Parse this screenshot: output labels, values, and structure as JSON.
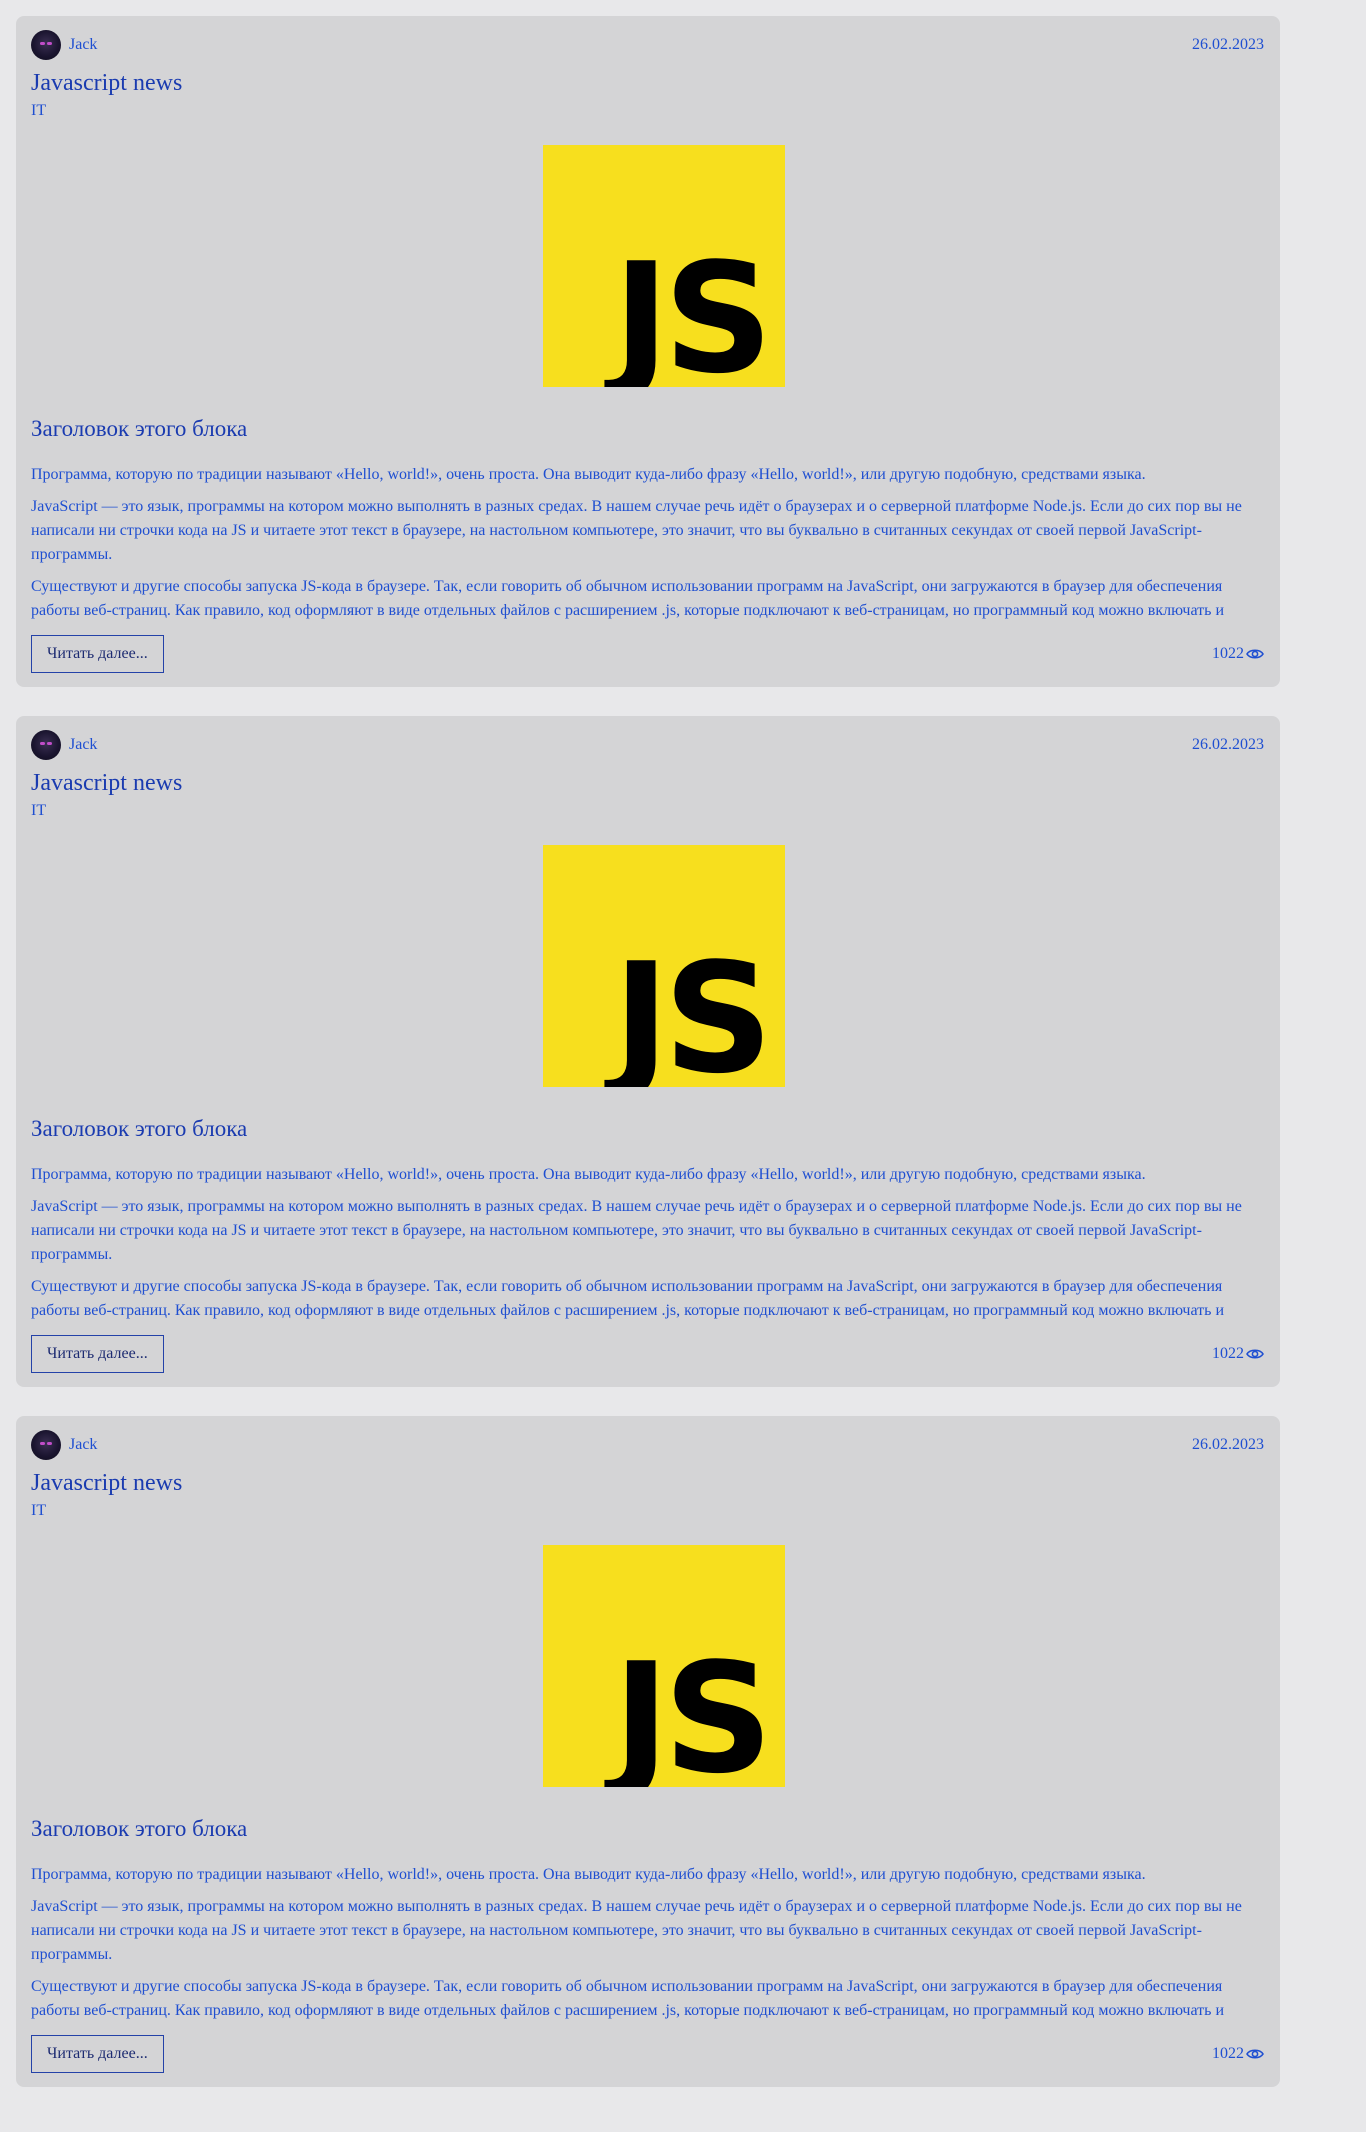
{
  "posts": [
    {
      "author": "Jack",
      "date": "26.02.2023",
      "title": "Javascript news",
      "category": "IT",
      "image_text": "JS",
      "block_heading": "Заголовок этого блока",
      "paragraphs": [
        "Программа, которую по традиции называют «Hello, world!», очень проста. Она выводит куда-либо фразу «Hello, world!», или другую подобную, средствами языка.",
        "JavaScript — это язык, программы на котором можно выполнять в разных средах. В нашем случае речь идёт о браузерах и о серверной платформе Node.js. Если до сих пор вы не написали ни строчки кода на JS и читаете этот текст в браузере, на настольном компьютере, это значит, что вы буквально в считанных секундах от своей первой JavaScript-программы.",
        "Существуют и другие способы запуска JS-кода в браузере. Так, если говорить об обычном использовании программ на JavaScript, они загружаются в браузер для обеспечения работы веб-страниц. Как правило, код оформляют в виде отдельных файлов с расширением .js, которые подключают к веб-страницам, но программный код можно включать и"
      ],
      "read_more_label": "Читать далее...",
      "views": "1022"
    },
    {
      "author": "Jack",
      "date": "26.02.2023",
      "title": "Javascript news",
      "category": "IT",
      "image_text": "JS",
      "block_heading": "Заголовок этого блока",
      "paragraphs": [
        "Программа, которую по традиции называют «Hello, world!», очень проста. Она выводит куда-либо фразу «Hello, world!», или другую подобную, средствами языка.",
        "JavaScript — это язык, программы на котором можно выполнять в разных средах. В нашем случае речь идёт о браузерах и о серверной платформе Node.js. Если до сих пор вы не написали ни строчки кода на JS и читаете этот текст в браузере, на настольном компьютере, это значит, что вы буквально в считанных секундах от своей первой JavaScript-программы.",
        "Существуют и другие способы запуска JS-кода в браузере. Так, если говорить об обычном использовании программ на JavaScript, они загружаются в браузер для обеспечения работы веб-страниц. Как правило, код оформляют в виде отдельных файлов с расширением .js, которые подключают к веб-страницам, но программный код можно включать и"
      ],
      "read_more_label": "Читать далее...",
      "views": "1022"
    },
    {
      "author": "Jack",
      "date": "26.02.2023",
      "title": "Javascript news",
      "category": "IT",
      "image_text": "JS",
      "block_heading": "Заголовок этого блока",
      "paragraphs": [
        "Программа, которую по традиции называют «Hello, world!», очень проста. Она выводит куда-либо фразу «Hello, world!», или другую подобную, средствами языка.",
        "JavaScript — это язык, программы на котором можно выполнять в разных средах. В нашем случае речь идёт о браузерах и о серверной платформе Node.js. Если до сих пор вы не написали ни строчки кода на JS и читаете этот текст в браузере, на настольном компьютере, это значит, что вы буквально в считанных секундах от своей первой JavaScript-программы.",
        "Существуют и другие способы запуска JS-кода в браузере. Так, если говорить об обычном использовании программ на JavaScript, они загружаются в браузер для обеспечения работы веб-страниц. Как правило, код оформляют в виде отдельных файлов с расширением .js, которые подключают к веб-страницам, но программный код можно включать и"
      ],
      "read_more_label": "Читать далее...",
      "views": "1022"
    }
  ],
  "icons": {
    "avatar": "avatar-image",
    "views": "eye-icon"
  },
  "colors": {
    "page_background": "#e8e8ea",
    "card_background": "#d4d4d6",
    "text_link": "#1f4fd1",
    "heading": "#1a3bb0",
    "js_logo_yellow": "#f7df1e",
    "js_logo_text": "#000000"
  }
}
